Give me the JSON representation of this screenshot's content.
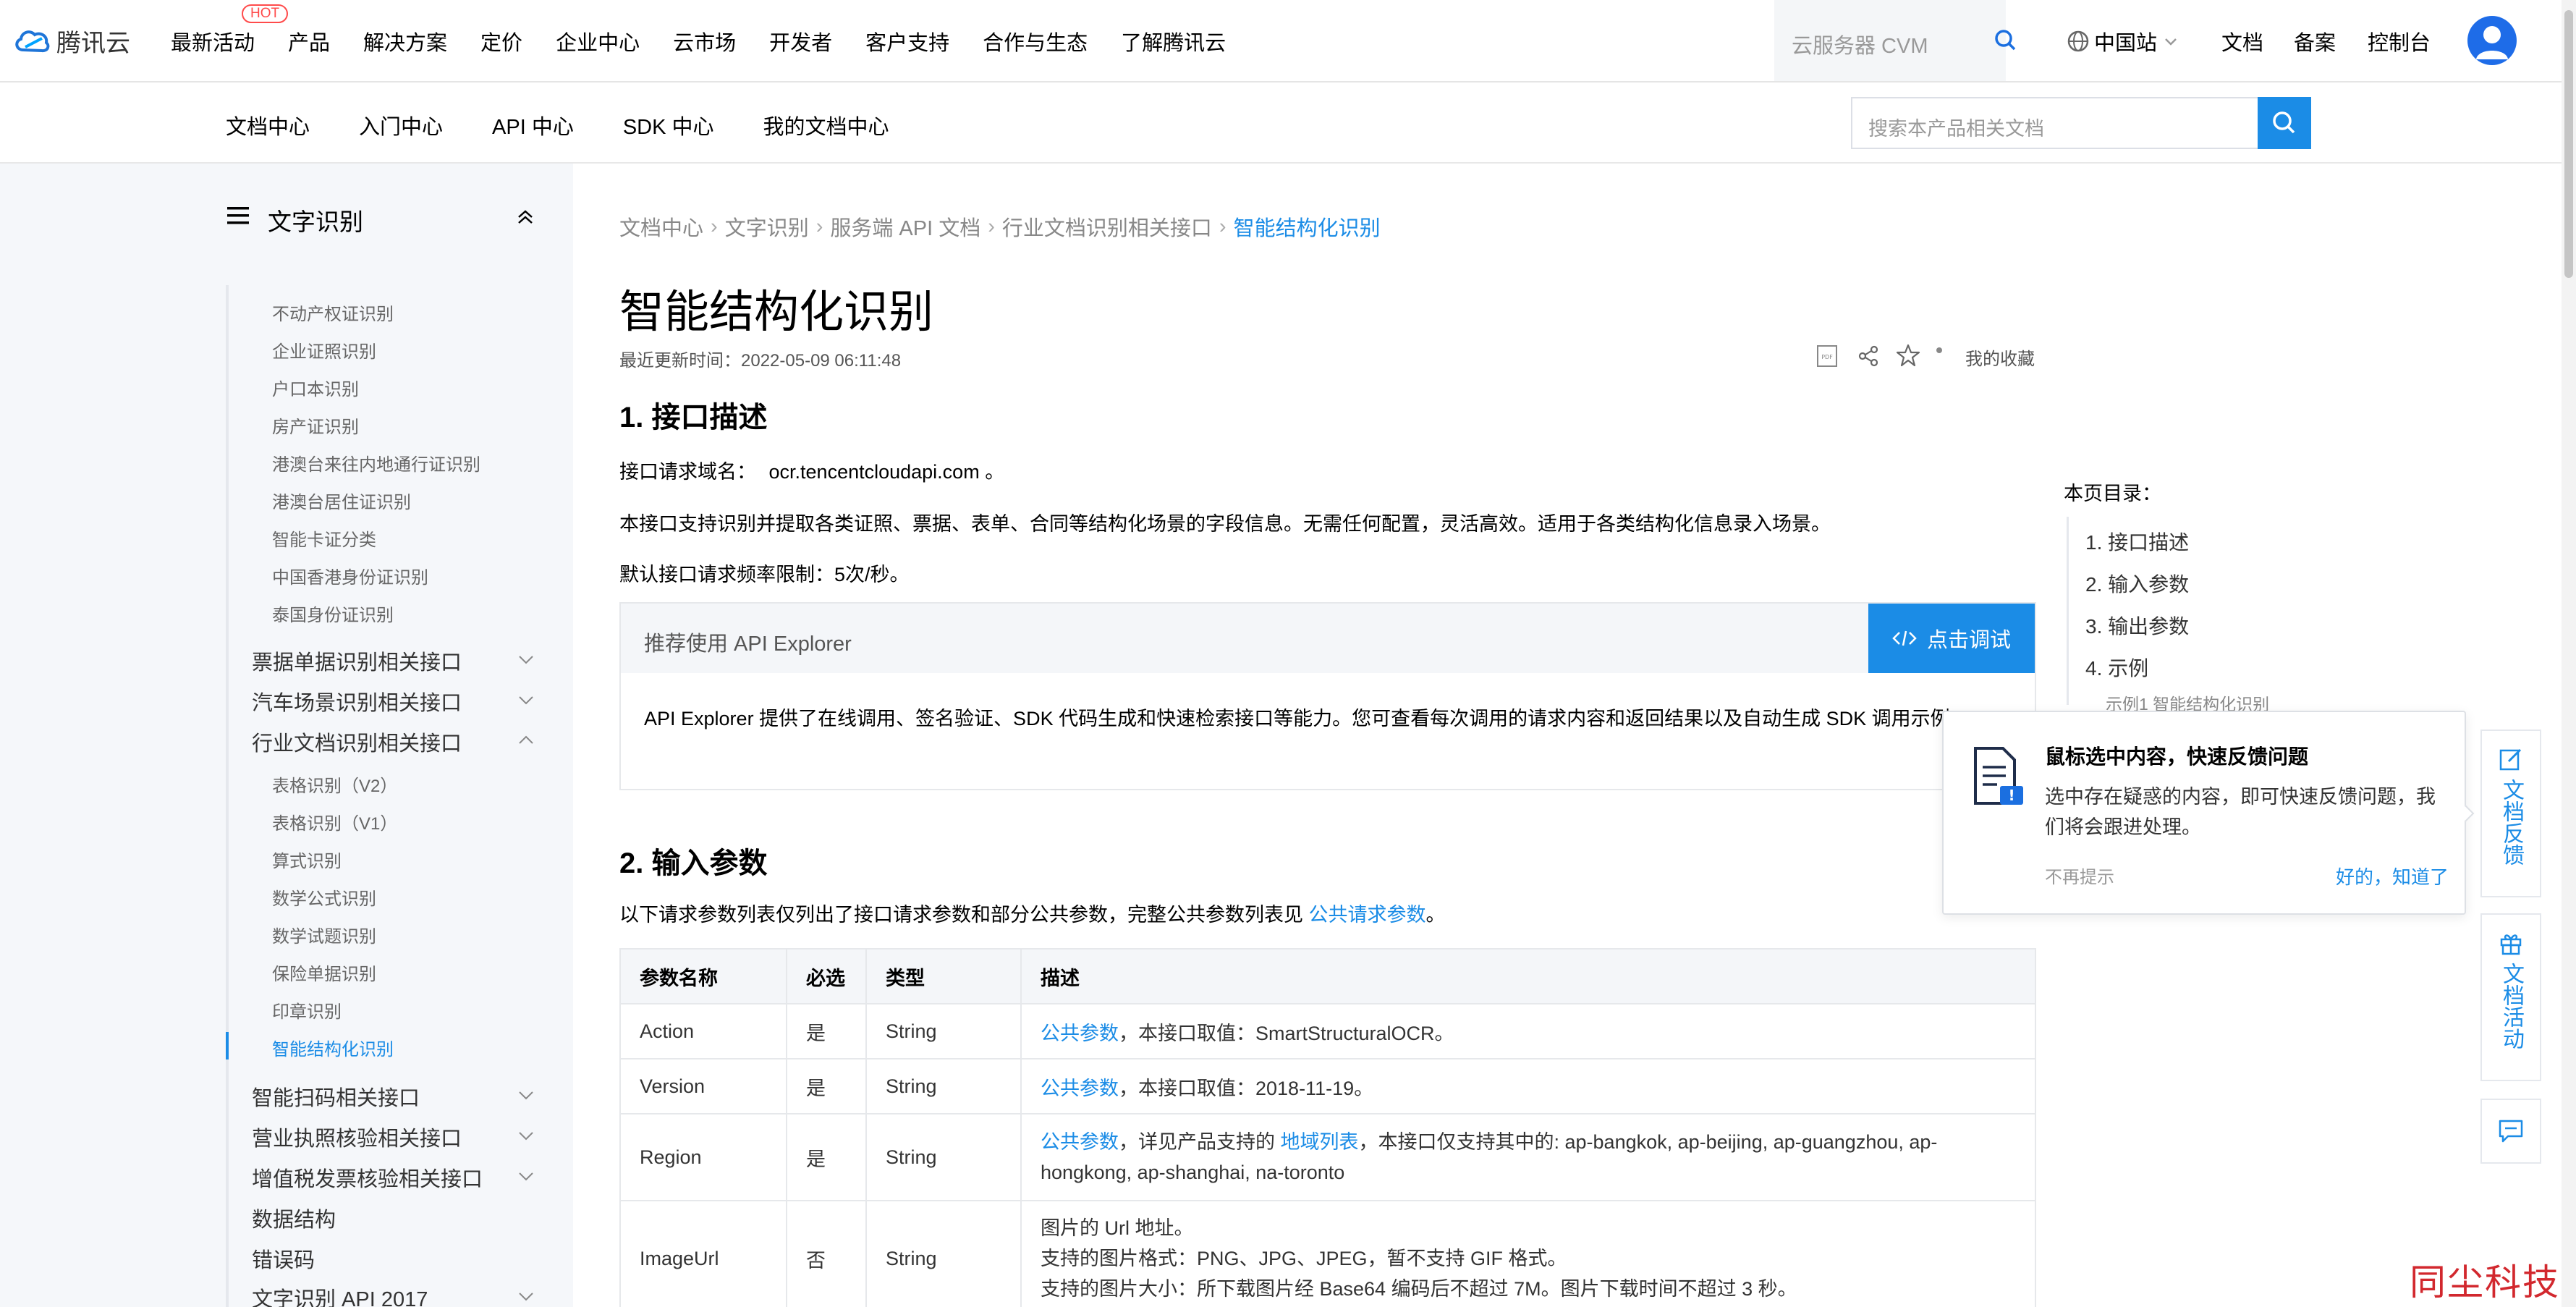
{
  "top_nav": {
    "logo_text": "腾讯云",
    "hot_badge": "HOT",
    "menu": [
      "最新活动",
      "产品",
      "解决方案",
      "定价",
      "企业中心",
      "云市场",
      "开发者",
      "客户支持",
      "合作与生态",
      "了解腾讯云"
    ],
    "search_placeholder": "云服务器 CVM",
    "region": "中国站",
    "links": [
      "文档",
      "备案",
      "控制台"
    ]
  },
  "sub_nav": {
    "items": [
      "文档中心",
      "入门中心",
      "API 中心",
      "SDK 中心",
      "我的文档中心"
    ],
    "search_placeholder": "搜索本产品相关文档"
  },
  "sidebar": {
    "title": "文字识别",
    "sub_items_top": [
      "不动产权证识别",
      "企业证照识别",
      "户口本识别",
      "房产证识别",
      "港澳台来往内地通行证识别",
      "港澳台居住证识别",
      "智能卡证分类",
      "中国香港身份证识别",
      "泰国身份证识别"
    ],
    "groups_a": [
      "票据单据识别相关接口",
      "汽车场景识别相关接口",
      "行业文档识别相关接口"
    ],
    "sub_items_industry": [
      "表格识别（V2）",
      "表格识别（V1）",
      "算式识别",
      "数学公式识别",
      "数学试题识别",
      "保险单据识别",
      "印章识别",
      "智能结构化识别"
    ],
    "groups_b": [
      "智能扫码相关接口",
      "营业执照核验相关接口",
      "增值税发票核验相关接口",
      "数据结构",
      "错误码",
      "文字识别 API 2017"
    ]
  },
  "breadcrumb": [
    "文档中心",
    "文字识别",
    "服务端 API 文档",
    "行业文档识别相关接口",
    "智能结构化识别"
  ],
  "page": {
    "title": "智能结构化识别",
    "updated": "最近更新时间：2022-05-09 06:11:48",
    "favorite": "我的收藏",
    "s1_title": "1. 接口描述",
    "domain_label": "接口请求域名：",
    "domain_value": "ocr.tencentcloudapi.com 。",
    "desc": "本接口支持识别并提取各类证照、票据、表单、合同等结构化场景的字段信息。无需任何配置，灵活高效。适用于各类结构化信息录入场景。",
    "rate": "默认接口请求频率限制：5次/秒。",
    "explorer_title": "推荐使用 API Explorer",
    "explorer_button": "点击调试",
    "explorer_body": "API Explorer 提供了在线调用、签名验证、SDK 代码生成和快速检索接口等能力。您可查看每次调用的请求内容和返回结果以及自动生成 SDK 调用示例。",
    "s2_title": "2. 输入参数",
    "s2_intro": "以下请求参数列表仅列出了接口请求参数和部分公共参数，完整公共参数列表见",
    "s2_link": "公共请求参数",
    "s2_end": "。"
  },
  "table": {
    "headers": [
      "参数名称",
      "必选",
      "类型",
      "描述"
    ],
    "rows": [
      {
        "name": "Action",
        "req": "是",
        "type": "String",
        "link": "公共参数",
        "desc": "，本接口取值：SmartStructuralOCR。"
      },
      {
        "name": "Version",
        "req": "是",
        "type": "String",
        "link": "公共参数",
        "desc": "，本接口取值：2018-11-19。"
      },
      {
        "name": "Region",
        "req": "是",
        "type": "String",
        "link": "公共参数",
        "desc_a": "，详见产品支持的 ",
        "link2": "地域列表",
        "desc_b": "，本接口仅支持其中的: ap-bangkok, ap-beijing, ap-guangzhou, ap-hongkong, ap-shanghai, na-toronto"
      },
      {
        "name": "ImageUrl",
        "req": "否",
        "type": "String",
        "lines": [
          "图片的 Url 地址。",
          "支持的图片格式：PNG、JPG、JPEG，暂不支持 GIF 格式。",
          "支持的图片大小：所下载图片经 Base64 编码后不超过 7M。图片下载时间不超过 3 秒。"
        ]
      }
    ]
  },
  "toc": {
    "title": "本页目录：",
    "items": [
      "1. 接口描述",
      "2. 输入参数",
      "3. 输出参数",
      "4. 示例"
    ],
    "sub": "示例1 智能结构化识别"
  },
  "popup": {
    "title": "鼠标选中内容，快速反馈问题",
    "text": "选中存在疑惑的内容，即可快速反馈问题，我们将会跟进处理。",
    "dismiss": "不再提示",
    "ok": "好的，知道了"
  },
  "float": {
    "feedback": "文档反馈",
    "activity": "文档活动"
  },
  "watermark": "同尘科技",
  "colors": {
    "accent": "#1b8ce6",
    "watermark": "#d2282e"
  }
}
